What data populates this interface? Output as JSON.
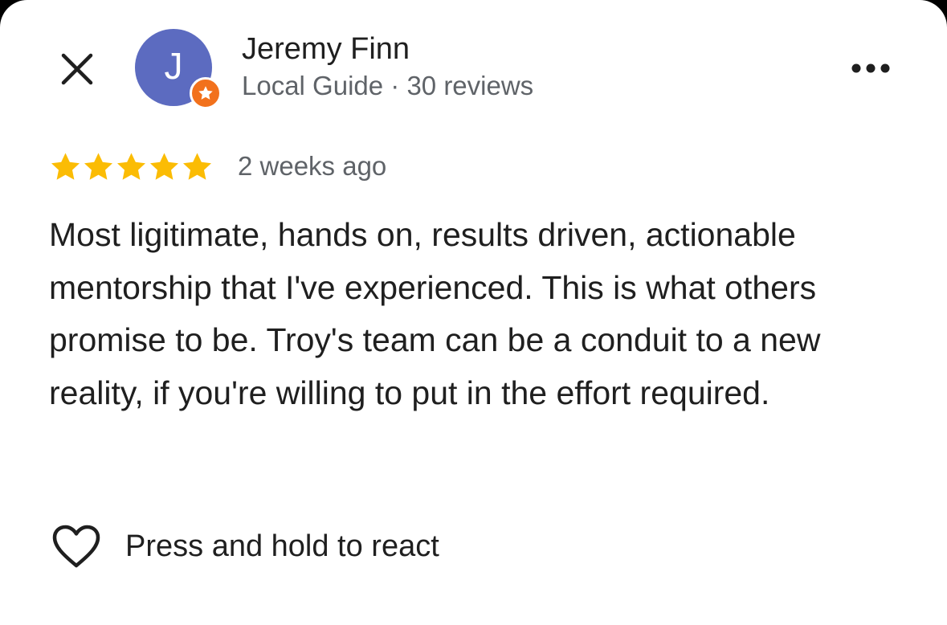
{
  "colors": {
    "avatar_bg": "#5c6bc0",
    "badge_bg": "#f2711c",
    "star": "#fbbc04",
    "text_primary": "#1f1f1f",
    "text_secondary": "#5f6368"
  },
  "header": {
    "close_icon": "close-icon",
    "avatar_initial": "J",
    "user_name": "Jeremy Finn",
    "user_meta": "Local Guide · 30 reviews",
    "more_icon": "more-horizontal-icon"
  },
  "review": {
    "rating": 5,
    "rating_max": 5,
    "date": "2 weeks ago",
    "text": "Most ligitimate, hands on, results driven, actionable mentorship that I've experienced. This is what others promise to be. Troy's team can be a conduit to a new reality, if you're willing to put in the effort required."
  },
  "react": {
    "icon": "heart-outline-icon",
    "label": "Press and hold to react"
  }
}
